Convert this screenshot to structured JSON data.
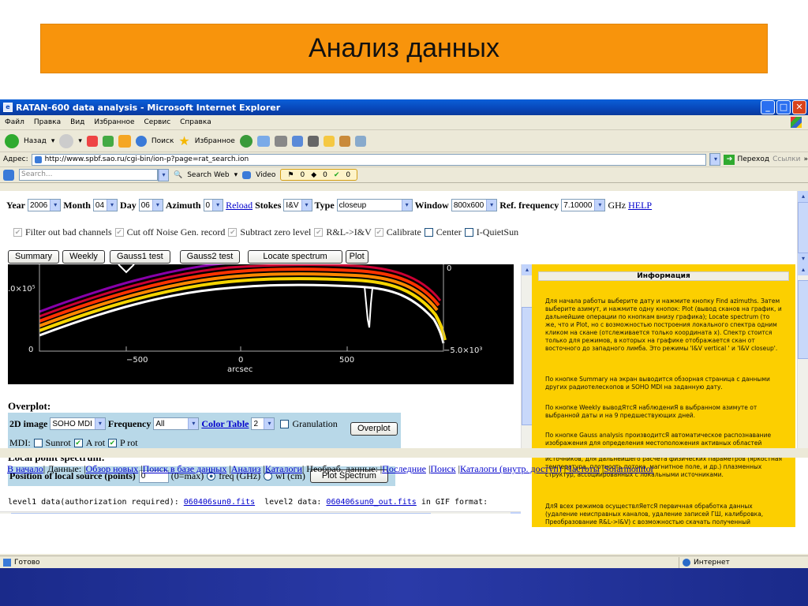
{
  "slide": {
    "title": "Анализ данных"
  },
  "window": {
    "title": "RATAN-600 data analysis - Microsoft Internet Explorer"
  },
  "menu": [
    "Файл",
    "Правка",
    "Вид",
    "Избранное",
    "Сервис",
    "Справка"
  ],
  "toolbar": {
    "back": "Назад",
    "search": "Поиск",
    "favorites": "Избранное"
  },
  "address": {
    "label": "Адрес:",
    "url": "http://www.spbf.sao.ru/cgi-bin/ion-p?page=rat_search.ion",
    "go": "Переход",
    "links": "Ссылки"
  },
  "searchbar": {
    "placeholder": "Search...",
    "search_web": "Search Web",
    "video": "Video",
    "count1": "0",
    "count2": "0",
    "count3": "0"
  },
  "form": {
    "year_label": "Year",
    "year": "2006",
    "month_label": "Month",
    "month": "04",
    "day_label": "Day",
    "day": "06",
    "azimuth_label": "Azimuth",
    "azimuth": "0",
    "reload": "Reload",
    "stokes_label": "Stokes",
    "stokes": "I&V",
    "type_label": "Type",
    "type": "closeup",
    "window_label": "Window",
    "window": "800x600",
    "ref_label": "Ref. frequency",
    "ref": "7.10000",
    "ghz": "GHz",
    "help": "HELP"
  },
  "options": {
    "filter": "Filter out bad channels",
    "cutoff": "Cut off Noise Gen. record",
    "subtract": "Subtract zero level",
    "rl": "R&L->I&V",
    "calibrate": "Calibrate",
    "center": "Center",
    "quiet": "I-QuietSun"
  },
  "buttons": {
    "summary": "Summary",
    "weekly": "Weekly",
    "gauss1": "Gauss1 test",
    "gauss2": "Gauss2 test",
    "locate": "Locate spectrum",
    "plot": "Plot"
  },
  "plot": {
    "xticks": [
      "−500",
      "0",
      "500"
    ],
    "xlabel": "arcsec",
    "y_top": ".0×10⁵",
    "y_zero": "0",
    "right_zero": "0",
    "right_neg": "−5.0×10³"
  },
  "overplot": {
    "title": "Overplot:",
    "image_label": "2D image",
    "image": "SOHO MDI",
    "freq_label": "Frequency",
    "freq": "All",
    "color_table": "Color Table",
    "color": "2",
    "granulation": "Granulation",
    "button": "Overplot",
    "mdi": "MDI:",
    "sunrot": "Sunrot",
    "arot": "A rot",
    "prot": "P rot"
  },
  "local": {
    "title": "Local point spectrum:",
    "position_label": "Position of local source (points)",
    "position": "0",
    "max": "(0=max)",
    "freq": "freq (GHz)",
    "wl": "wl (cm)",
    "button": "Plot Spectrum"
  },
  "levels": {
    "l1": "level1 data(authorization required):",
    "f1": "060406sun0.fits",
    "l2": "level2 data:",
    "f2": "060406sun0_out.fits",
    "gif": "in GIF format:"
  },
  "info": {
    "title": "Информация",
    "p1": "Для начала работы выберите дату и нажмите кнопку Find azimuths. Затем выберите азимут, и нажмите одну кнопок: Plot (вывод сканов на график, и дальнейшие операции по кнопкам внизу графика); Locate spectrum (то же, что и Plot, но с возможностью построения локального спектра одним кликом на скане (отслеживается только координата x). Спектр стоится только для режимов, в которых на графике отображается скан от восточного до западного лимба. Это режимы 'I&V vertical ' и 'I&V closeup'.",
    "p2": "По кнопке Summary на экран выводится обзорная страница с данными других радиотелескопов и SOHO MDI на заданную дату.",
    "p3": "По кнопке Weekly выводЯтсЯ наблюдениЯ в выбранном азимуте от выбранной даты и на 9 предшествующих дней.",
    "p4": "По кнопке Gauss analysis производитсЯ автоматическое распознавание изображения для определения местоположения активных областей (itype='Find local sources'), с гаусс-анализом найденных локальных источников, для дальнейшего расчета физических параметров (яркостная температура, плотность потока, магнитное поле, и др.) плазменных структур, ассоциированных с локальными источниками.",
    "p5": "ДлЯ всех режимов осуществлЯетсЯ первичная обработка данных (удаление неисправных каналов, удаление записей ГШ, калибровка, Преобразование R&L->I&V) с возможностью скачать полученный"
  },
  "bottom": {
    "home": "В начало",
    "data": "| Данные: |",
    "review": "Обзор новых",
    "dbsearch": "Поиск в базе данных",
    "analysis": "Анализ",
    "catalogs": "Каталоги",
    "raw": "| Необраб. данные: |",
    "latest": "Последние",
    "search": "Поиск",
    "catalogs_int": "Каталоги (внутр. доступ)",
    "freqs": "Частоты",
    "solarmonitor": "Solarmonitor"
  },
  "status": {
    "ready": "Готово",
    "zone": "Интернет"
  }
}
